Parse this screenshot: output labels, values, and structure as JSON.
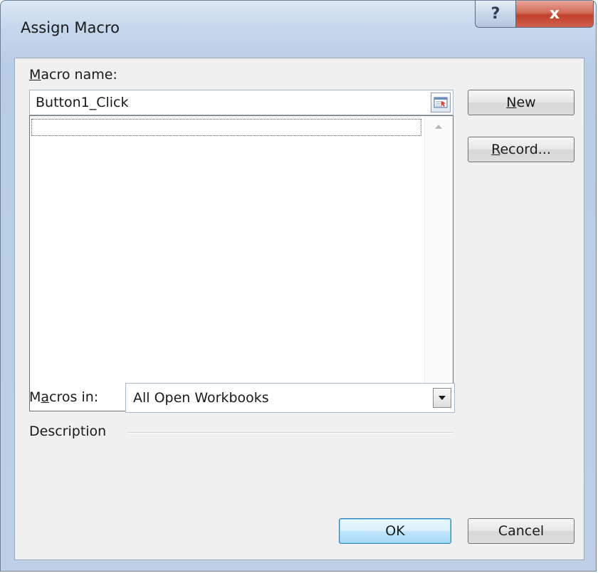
{
  "window": {
    "title": "Assign Macro",
    "help_glyph": "?",
    "close_glyph": "x"
  },
  "macro_name": {
    "label_underlined": "M",
    "label_rest": "acro name:",
    "value": "Button1_Click"
  },
  "macro_list": {
    "items": [
      ""
    ]
  },
  "buttons": {
    "new_underlined": "N",
    "new_rest": "ew",
    "record_underlined": "R",
    "record_rest": "ecord...",
    "ok": "OK",
    "cancel": "Cancel"
  },
  "macros_in": {
    "label_pre": "M",
    "label_underlined": "a",
    "label_rest": "cros in:",
    "selected": "All Open Workbooks"
  },
  "description": {
    "label": "Description"
  },
  "icons": {
    "help": "help-icon",
    "close": "close-icon",
    "ref_edit": "collapse-dialog-icon",
    "dropdown": "chevron-down-icon",
    "scroll_up": "scroll-up-arrow-icon",
    "scroll_down": "scroll-down-arrow-icon"
  },
  "colors": {
    "title_bar": "#c5d7ec",
    "close_button": "#c2402b",
    "dialog_body": "#f0f0f0",
    "default_button_border": "#3c7fb1"
  }
}
